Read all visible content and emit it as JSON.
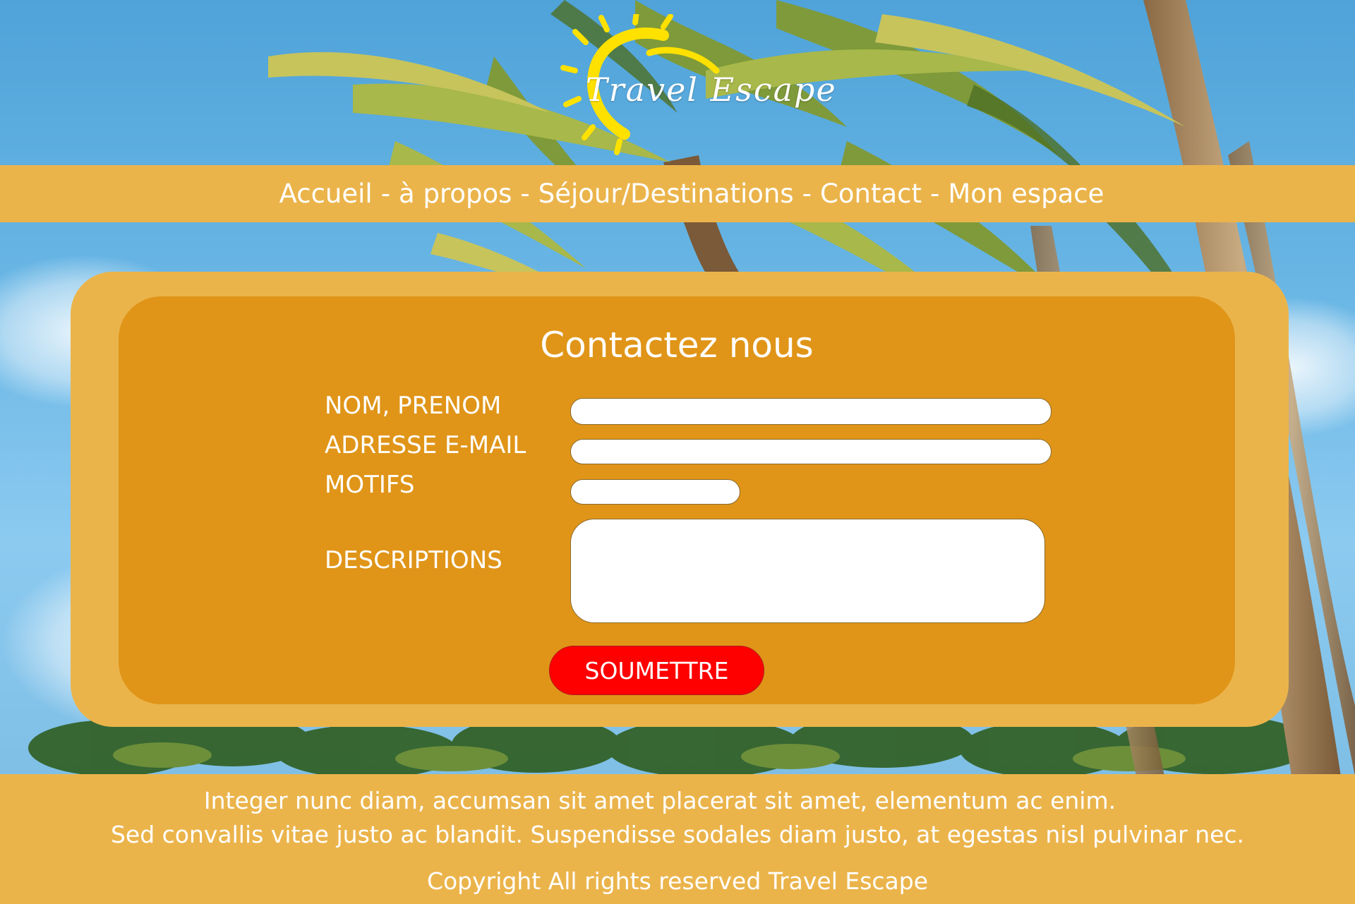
{
  "site": {
    "brand_name": "Travel Escape",
    "brand_color": "#ebb44b",
    "panel_color": "#e09518",
    "accent_color": "#ff0000",
    "background_image": "palm-trees-blue-sky"
  },
  "nav": {
    "separator": "-",
    "items": [
      {
        "label": "Accueil"
      },
      {
        "label": "à propos"
      },
      {
        "label": "Séjour/Destinations"
      },
      {
        "label": "Contact"
      },
      {
        "label": "Mon espace"
      }
    ]
  },
  "contact": {
    "title": "Contactez nous",
    "fields": {
      "name": {
        "label": "NOM, PRENOM",
        "value": ""
      },
      "email": {
        "label": "ADRESSE E-MAIL",
        "value": ""
      },
      "reason": {
        "label": "MOTIFS",
        "value": ""
      },
      "description": {
        "label": "DESCRIPTIONS",
        "value": ""
      }
    },
    "submit_label": "SOUMETTRE"
  },
  "footer": {
    "line1": "Integer nunc diam, accumsan sit amet placerat sit amet, elementum ac enim.",
    "line2": "Sed convallis vitae justo ac blandit. Suspendisse sodales diam justo, at egestas nisl pulvinar nec.",
    "copyright": "Copyright All rights reserved Travel Escape"
  }
}
